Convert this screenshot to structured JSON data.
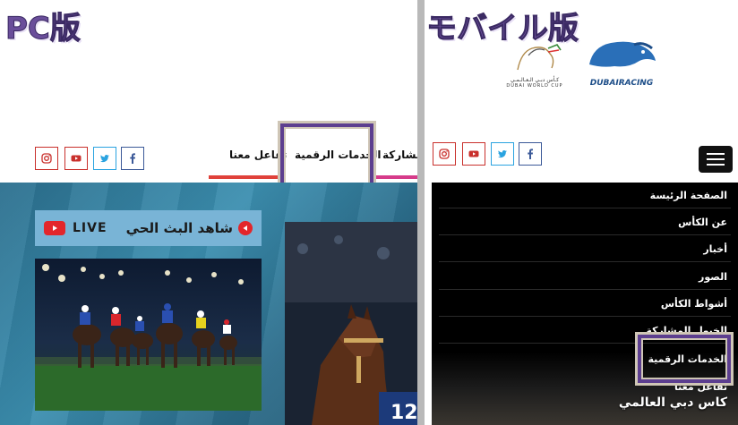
{
  "pc": {
    "title": "PC版",
    "nav": {
      "interact": "تفاعل معنا",
      "digital_services": "الخدمات الرقمية",
      "participation": "المشاركة"
    },
    "social": [
      "instagram-icon",
      "youtube-icon",
      "twitter-icon",
      "facebook-icon"
    ],
    "live": {
      "label": "LIVE",
      "watch": "شاهد البث الحي"
    }
  },
  "mobile": {
    "title": "モバイル版",
    "logos": {
      "worldcup_arabic": "كـأس دبـي الـعـالـمـي",
      "worldcup": "DUBAI WORLD CUP",
      "dubairacing": "DUBAIRACING"
    },
    "social": [
      "instagram-icon",
      "youtube-icon",
      "twitter-icon",
      "facebook-icon"
    ],
    "menu": [
      "الصفحة الرئيسة",
      "عن الكأس",
      "أخبار",
      "الصور",
      "أشواط الكأس",
      "الخيول المشاركة",
      "الخدمات الرقمية",
      "تفاعل معنا"
    ],
    "hero_title": "كاس دبي العالمي"
  },
  "colors": {
    "accent_purple": "#5c3e8f",
    "instagram": "#c9302c",
    "youtube": "#c9302c",
    "twitter": "#2aa3e0",
    "facebook": "#3b5998",
    "underline_red": "#e0413a",
    "underline_pink": "#d63b8a"
  }
}
